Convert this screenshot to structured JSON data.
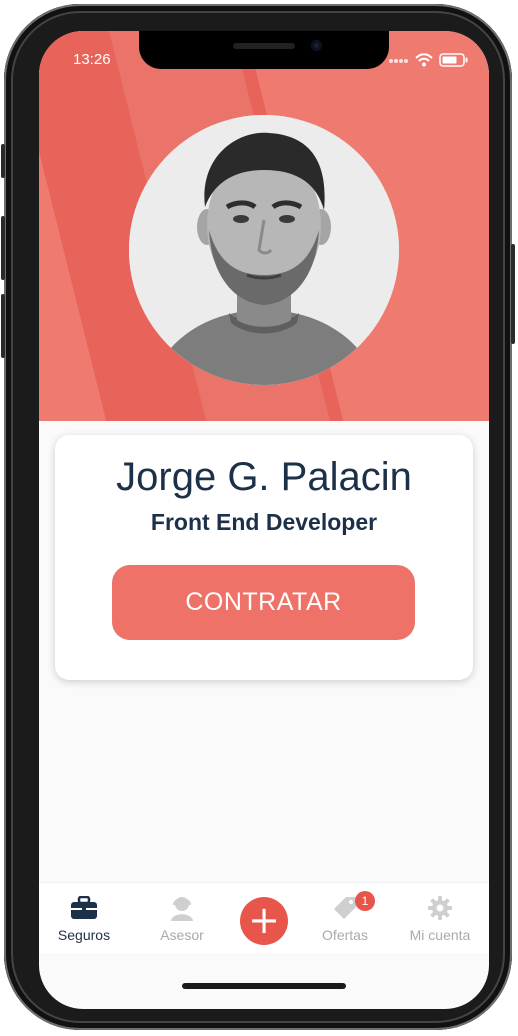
{
  "status_bar": {
    "time": "13:26"
  },
  "profile": {
    "name": "Jorge G. Palacin",
    "role": "Front End Developer",
    "cta_label": "CONTRATAR"
  },
  "tabbar": {
    "items": [
      {
        "label": "Seguros",
        "icon": "briefcase-icon",
        "active": true
      },
      {
        "label": "Asesor",
        "icon": "advisor-icon",
        "active": false
      },
      {
        "label": "",
        "icon": "plus-icon",
        "active": false
      },
      {
        "label": "Ofertas",
        "icon": "tag-icon",
        "active": false,
        "badge": "1"
      },
      {
        "label": "Mi cuenta",
        "icon": "gear-icon",
        "active": false
      }
    ]
  },
  "colors": {
    "accent": "#ee7268",
    "accent_dark": "#e8554b",
    "text_primary": "#1d3049",
    "tab_inactive": "#aaaaaa"
  }
}
